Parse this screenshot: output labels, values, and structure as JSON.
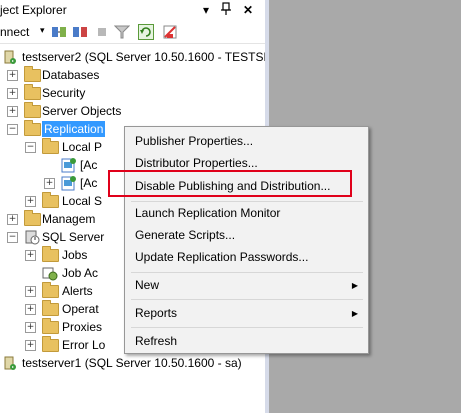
{
  "window": {
    "title": "ject Explorer",
    "pin_glyph": "▾",
    "autohide_glyph": "ᛰ",
    "close_glyph": "✕"
  },
  "toolbar": {
    "connect_label": "nnect",
    "connect_arrow": "▾",
    "icons": [
      "connect-object-explorer-icon",
      "disconnect-icon",
      "stop-icon",
      "filter-icon",
      "refresh-icon",
      "activity-monitor-icon"
    ]
  },
  "tree": {
    "server2": "testserver2 (SQL Server 10.50.1600 - TESTSERV",
    "databases": "Databases",
    "security": "Security",
    "server_objects": "Server Objects",
    "replication": "Replication",
    "local_publications": "Local P",
    "pub1": "[Ac",
    "pub2": "[Ac",
    "local_subscriptions": "Local S",
    "management": "Managem",
    "sql_agent": "SQL Server",
    "jobs": "Jobs",
    "job_activity": "Job Ac",
    "alerts": "Alerts",
    "operators": "Operat",
    "proxies": "Proxies",
    "error_logs": "Error Lo",
    "server1": "testserver1 (SQL Server 10.50.1600 - sa)",
    "expand_glyph": "+",
    "collapse_glyph": "−"
  },
  "context_menu": {
    "publisher_properties": "Publisher Properties...",
    "distributor_properties": "Distributor Properties...",
    "disable_publishing": "Disable Publishing and Distribution...",
    "launch_monitor": "Launch Replication Monitor",
    "generate_scripts": "Generate Scripts...",
    "update_passwords": "Update Replication Passwords...",
    "new": "New",
    "reports": "Reports",
    "refresh": "Refresh",
    "submenu_arrow": "▶"
  },
  "colors": {
    "selection": "#3399ff",
    "highlight_box": "#e0001a",
    "menu_background": "#f2f2f2",
    "document_area": "#a9a9a9"
  }
}
